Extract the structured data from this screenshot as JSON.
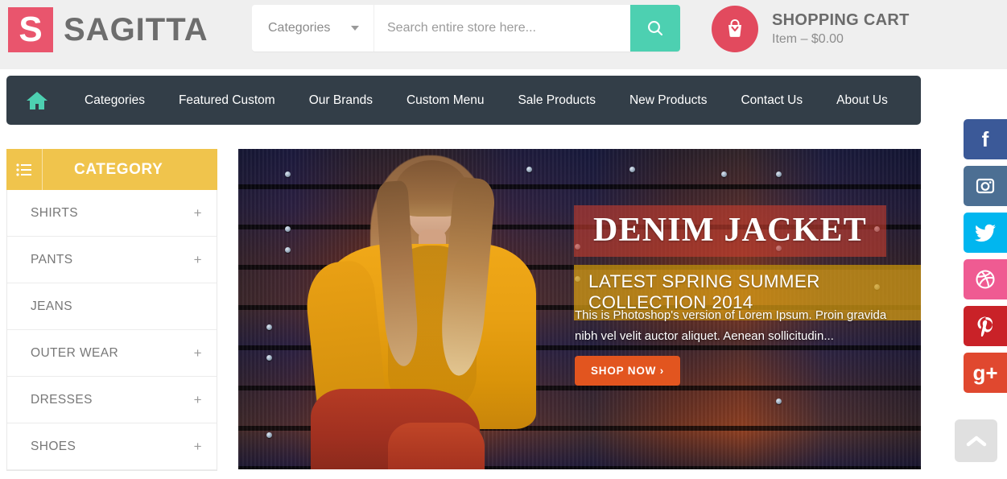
{
  "header": {
    "logo": {
      "mark": "S",
      "text": "SAGITTA",
      "mark_color": "#e9556d"
    },
    "search": {
      "category_label": "Categories",
      "placeholder": "Search entire store here...",
      "value": "",
      "button_icon": "search-icon",
      "button_color": "#4dd0b1"
    },
    "cart": {
      "icon": "shopping-basket-icon",
      "title": "SHOPPING CART",
      "summary": "Item – $0.00",
      "circle_color": "#e24a5e"
    },
    "background_color": "#efefef"
  },
  "nav": {
    "background_color": "#333e48",
    "home_icon": "home-icon",
    "home_icon_color": "#4dd0b1",
    "items": [
      {
        "label": "Categories"
      },
      {
        "label": "Featured Custom"
      },
      {
        "label": "Our Brands"
      },
      {
        "label": "Custom Menu"
      },
      {
        "label": "Sale Products"
      },
      {
        "label": "New Products"
      },
      {
        "label": "Contact Us"
      },
      {
        "label": "About Us"
      }
    ]
  },
  "sidebar": {
    "header": {
      "icon": "list-icon",
      "title": "CATEGORY",
      "color": "#f0c44c"
    },
    "items": [
      {
        "label": "SHIRTS",
        "expander": "+"
      },
      {
        "label": "PANTS",
        "expander": "+"
      },
      {
        "label": "JEANS",
        "expander": ""
      },
      {
        "label": "OUTER WEAR",
        "expander": "+"
      },
      {
        "label": "DRESSES",
        "expander": "+"
      },
      {
        "label": "SHOES",
        "expander": "+"
      }
    ]
  },
  "hero": {
    "title": "DENIM JACKET",
    "subtitle": "LATEST SPRING SUMMER COLLECTION 2014",
    "description": "This is Photoshop's version of Lorem Ipsum. Proin gravida nibh vel velit auctor aliquet. Aenean sollicitudin...",
    "button_label": "SHOP NOW ›",
    "button_color": "#e2551f",
    "title_band_color": "#c53e2f",
    "subtitle_band_color": "#daa014"
  },
  "social": [
    {
      "name": "facebook",
      "glyph": "f",
      "color": "#3b5998"
    },
    {
      "name": "instagram",
      "glyph": "",
      "color": "#4c6f93"
    },
    {
      "name": "twitter",
      "glyph": "",
      "color": "#01b6ef"
    },
    {
      "name": "dribbble",
      "glyph": "",
      "color": "#ef5b92"
    },
    {
      "name": "pinterest",
      "glyph": "",
      "color": "#c92228"
    },
    {
      "name": "googleplus",
      "glyph": "g+",
      "color": "#e0482f"
    }
  ],
  "scroll_top": {
    "icon": "chevron-up-icon",
    "color": "#e0e0e0"
  }
}
